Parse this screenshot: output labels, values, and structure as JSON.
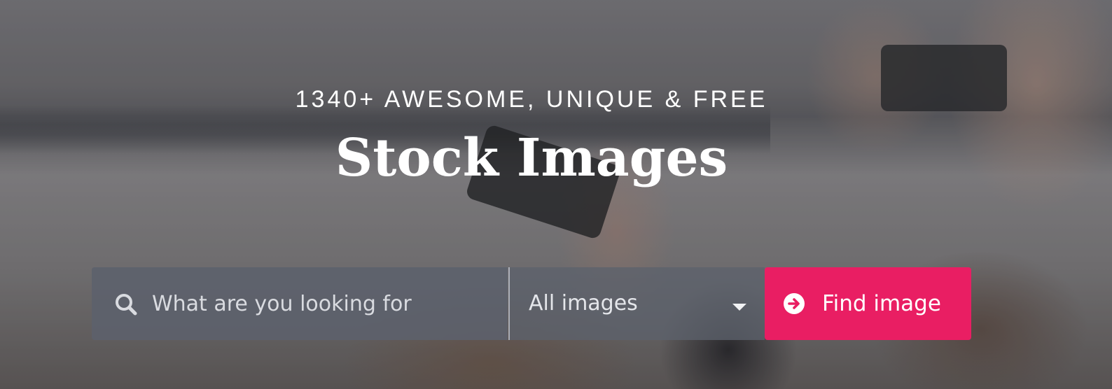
{
  "hero": {
    "kicker": "1340+ AWESOME, UNIQUE & FREE",
    "title": "Stock Images"
  },
  "search": {
    "placeholder": "What are you looking for",
    "icon": "search-icon"
  },
  "category": {
    "selected": "All images",
    "icon": "caret-down-icon"
  },
  "button": {
    "label": "Find image",
    "icon": "arrow-circle-right-icon"
  },
  "colors": {
    "accent": "#e91e63",
    "text": "#ffffff"
  }
}
